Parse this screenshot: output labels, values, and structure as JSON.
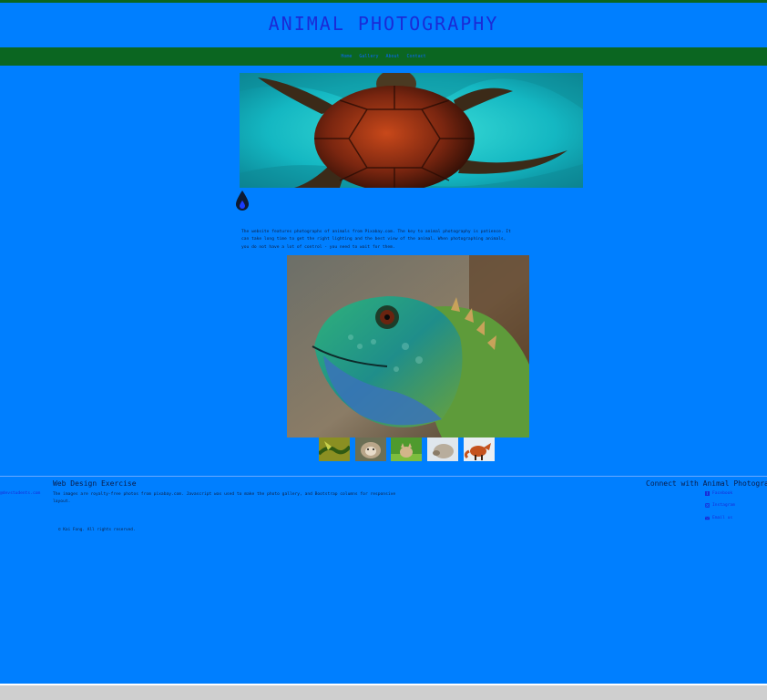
{
  "site": {
    "title": "ANIMAL PHOTOGRAPHY"
  },
  "nav": {
    "items": [
      {
        "label": "Home"
      },
      {
        "label": "Gallery"
      },
      {
        "label": "About"
      },
      {
        "label": "Contact"
      }
    ]
  },
  "hero": {
    "icon": "turtle-photo"
  },
  "drop_icon": "water-drop-icon",
  "intro": {
    "text": "The website features photographs of animals from Pixabay.com. The key to animal photography is patience. It can take long time to get the right lighting and the best view of the animal. When photographing animals, you do not have a lot of control - you need to wait for them."
  },
  "gallery": {
    "main_image": "iguana-photo",
    "thumbnails": [
      {
        "name": "snake-thumb"
      },
      {
        "name": "hedgehog-thumb"
      },
      {
        "name": "kitten-thumb"
      },
      {
        "name": "porcupine-thumb"
      },
      {
        "name": "fox-thumb"
      }
    ]
  },
  "footer": {
    "title": "Web Design Exercise",
    "email": "@devstudents.com",
    "description": "The images are royalty-free photos from pixabay.com. Javascript was used to make the photo gallery, and Bootstrap columns for responsive layout.",
    "copyright": "© Kai Fong. All rights reserved.",
    "connect_title": "Connect with Animal Photography",
    "social": [
      {
        "label": "Facebook",
        "icon": "facebook-icon"
      },
      {
        "label": "Instagram",
        "icon": "instagram-icon"
      },
      {
        "label": "Email us",
        "icon": "email-icon"
      }
    ]
  },
  "colors": {
    "background": "#007fff",
    "nav_green": "#0b6621",
    "title_blue": "#1a2bd6",
    "footer_gray": "#cfcfcf"
  }
}
